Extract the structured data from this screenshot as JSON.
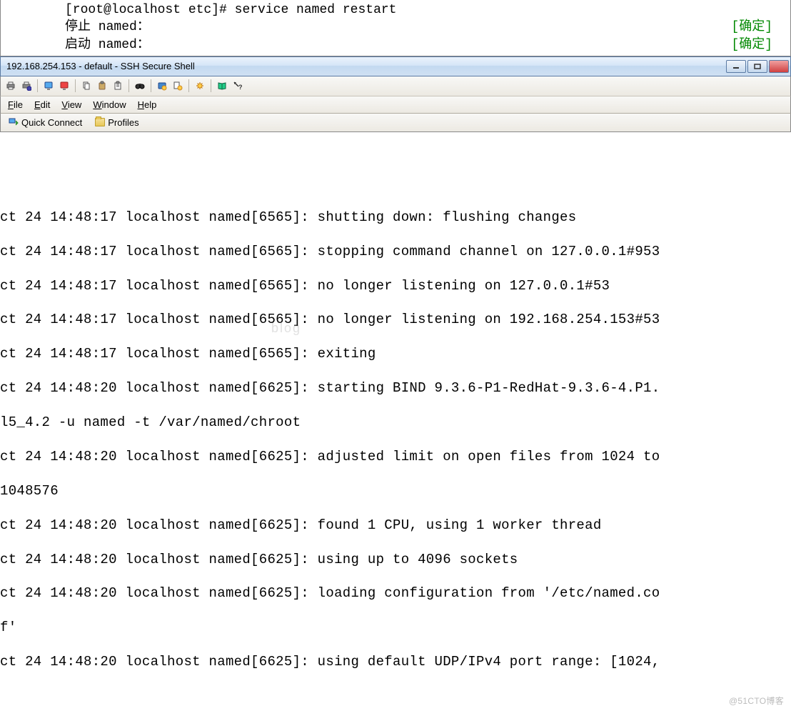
{
  "bg_terminal": {
    "prompt": "[root@localhost etc]# service named restart",
    "stop_label": "停止 named：",
    "start_label": "启动 named：",
    "stop_status": "[确定]",
    "start_status": "[确定]"
  },
  "window": {
    "title": "192.168.254.153 - default - SSH Secure Shell"
  },
  "toolbar_icons": [
    "printer-icon",
    "print-setup-icon",
    "monitor-icon",
    "computer-red-icon",
    "copy-icon",
    "paste-icon",
    "clipboard-icon",
    "binoculars-icon",
    "gear-blue-icon",
    "gear-yellow-icon",
    "gear-icon",
    "book-icon",
    "help-context-icon"
  ],
  "menu": {
    "file": "File",
    "edit": "Edit",
    "view": "View",
    "window": "Window",
    "help": "Help"
  },
  "connectbar": {
    "quick_connect": "Quick Connect",
    "profiles": "Profiles"
  },
  "log_lines": [
    "ct 24 14:48:17 localhost named[6565]: shutting down: flushing changes",
    "ct 24 14:48:17 localhost named[6565]: stopping command channel on 127.0.0.1#953",
    "ct 24 14:48:17 localhost named[6565]: no longer listening on 127.0.0.1#53",
    "ct 24 14:48:17 localhost named[6565]: no longer listening on 192.168.254.153#53",
    "ct 24 14:48:17 localhost named[6565]: exiting",
    "ct 24 14:48:20 localhost named[6625]: starting BIND 9.3.6-P1-RedHat-9.3.6-4.P1.",
    "l5_4.2 -u named -t /var/named/chroot",
    "ct 24 14:48:20 localhost named[6625]: adjusted limit on open files from 1024 to",
    "1048576",
    "ct 24 14:48:20 localhost named[6625]: found 1 CPU, using 1 worker thread",
    "ct 24 14:48:20 localhost named[6625]: using up to 4096 sockets",
    "ct 24 14:48:20 localhost named[6625]: loading configuration from '/etc/named.co",
    "f'",
    "ct 24 14:48:20 localhost named[6625]: using default UDP/IPv4 port range: [1024,"
  ],
  "watermark": "blog",
  "footer_mark": "@51CTO博客"
}
